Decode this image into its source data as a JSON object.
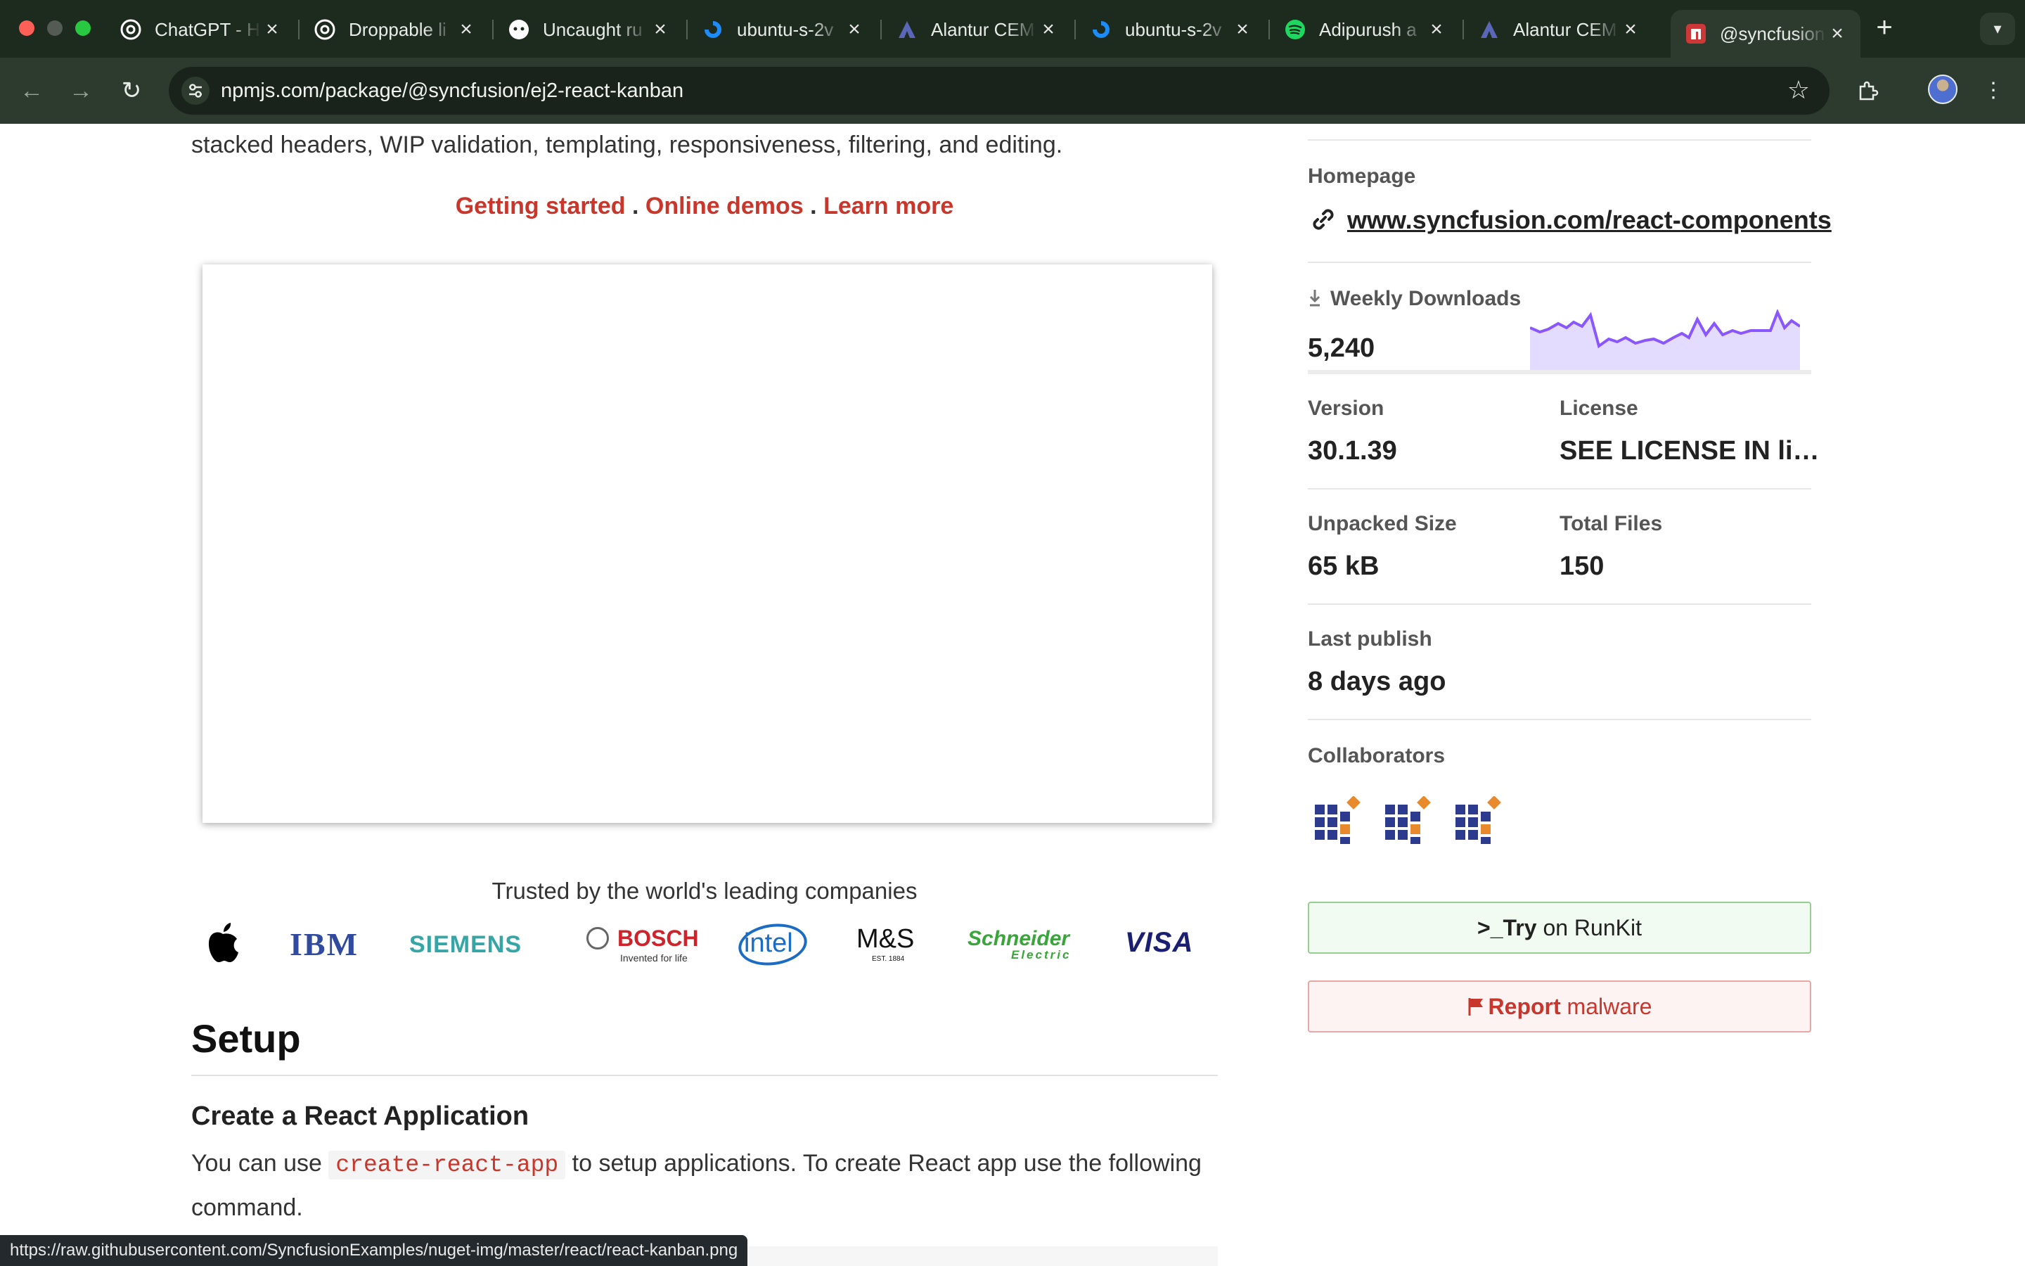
{
  "browser": {
    "tabs": [
      {
        "title": "ChatGPT - Help",
        "favicon": "chatgpt-icon"
      },
      {
        "title": "Droppable li",
        "favicon": "chatgpt-icon"
      },
      {
        "title": "Uncaught ru",
        "favicon": "github-icon"
      },
      {
        "title": "ubuntu-s-2v",
        "favicon": "digitalocean-icon"
      },
      {
        "title": "Alantur CEM",
        "favicon": "alantur-icon"
      },
      {
        "title": "ubuntu-s-2v",
        "favicon": "digitalocean-icon"
      },
      {
        "title": "Adipurush a",
        "favicon": "spotify-icon"
      },
      {
        "title": "Alantur CEM",
        "favicon": "alantur-icon"
      },
      {
        "title": "@syncfusion",
        "favicon": "npm-icon"
      }
    ],
    "active_tab_index": 8,
    "new_tab_label": "+",
    "url": "npmjs.com/package/@syncfusion/ej2-react-kanban",
    "status_url": "https://raw.githubusercontent.com/SyncfusionExamples/nuget-img/master/react/react-kanban.png",
    "colors": {
      "chrome": "#1d2a1e",
      "toolbar": "#2d3a2e"
    }
  },
  "readme": {
    "intro": "stacked headers, WIP validation, templating, responsiveness, filtering, and editing.",
    "links": [
      {
        "label": "Getting started"
      },
      {
        "label": "Online demos"
      },
      {
        "label": "Learn more"
      }
    ],
    "link_separator": ".",
    "trusted_text": "Trusted by the world's leading companies",
    "logos": {
      "ibm": "IBM",
      "siemens": "SIEMENS",
      "bosch": "BOSCH",
      "bosch_tagline": "Invented for life",
      "intel": "intel",
      "ms": "M&S",
      "ms_tagline": "EST. 1884",
      "schneider": "Schneider",
      "schneider_sub": "Electric",
      "visa": "VISA"
    },
    "setup_heading": "Setup",
    "create_heading": "Create a React Application",
    "para_before": "You can use",
    "para_code": "create-react-app",
    "para_after": "to setup applications. To create React app use the following command.",
    "link_color": "#c9362b"
  },
  "sidebar": {
    "homepage_label": "Homepage",
    "homepage_url": "www.syncfusion.com/react-components",
    "weekly_downloads_label": "Weekly Downloads",
    "weekly_downloads_value": "5,240",
    "version_label": "Version",
    "version_value": "30.1.39",
    "license_label": "License",
    "license_value": "SEE LICENSE IN li…",
    "unpacked_size_label": "Unpacked Size",
    "unpacked_size_value": "65 kB",
    "total_files_label": "Total Files",
    "total_files_value": "150",
    "last_publish_label": "Last publish",
    "last_publish_value": "8 days ago",
    "collaborators_label": "Collaborators",
    "runkit_prefix": ">_",
    "runkit_bold": "Try",
    "runkit_rest": " on RunKit",
    "report_bold": "Report",
    "report_rest": " malware",
    "sparkline_color": "#8956ff"
  }
}
